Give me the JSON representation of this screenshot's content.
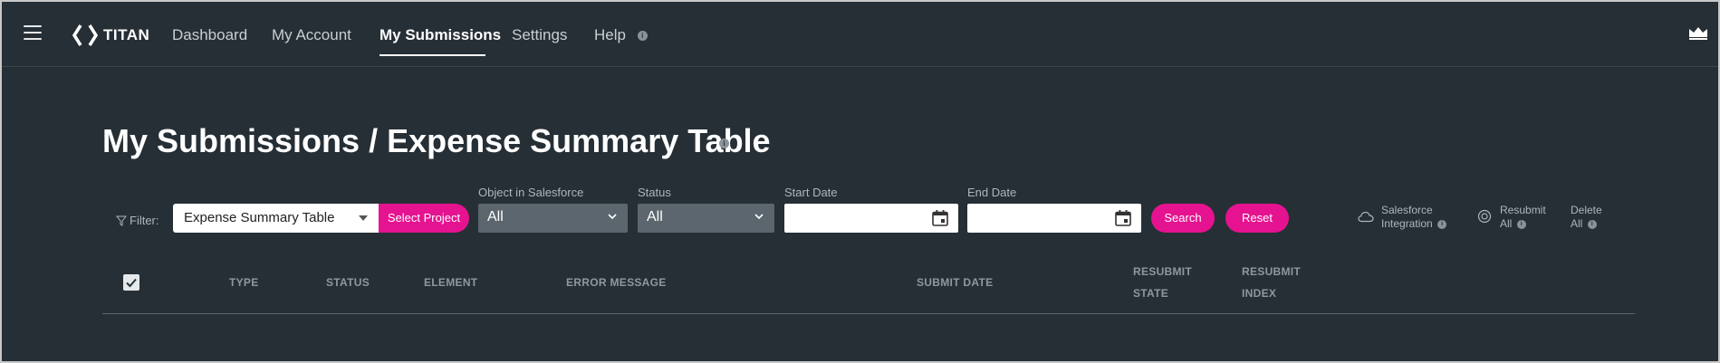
{
  "nav": {
    "brand": "TITAN",
    "items": [
      {
        "label": "Dashboard"
      },
      {
        "label": "My Account"
      },
      {
        "label": "My Submissions",
        "active": true
      },
      {
        "label": "Settings"
      },
      {
        "label": "Help"
      }
    ],
    "info_glyph": "i",
    "icons": [
      "menu-icon",
      "titan-logo-icon",
      "info-icon",
      "crown-icon"
    ]
  },
  "page": {
    "title": "My Submissions / Expense Summary Table"
  },
  "filter": {
    "label": "Filter:",
    "project_value": "Expense Summary Table",
    "select_project_label": "Select Project",
    "object_label": "Object in Salesforce",
    "object_value": "All",
    "status_label": "Status",
    "status_value": "All",
    "start_date_label": "Start Date",
    "start_date_value": "",
    "end_date_label": "End Date",
    "end_date_value": "",
    "search_label": "Search",
    "reset_label": "Reset"
  },
  "actions": {
    "salesforce_line1": "Salesforce",
    "salesforce_line2": "Integration",
    "resubmit_line1": "Resubmit",
    "resubmit_line2": "All",
    "delete_line1": "Delete",
    "delete_line2": "All"
  },
  "table": {
    "select_all_checked": true,
    "columns": {
      "type": "TYPE",
      "status": "STATUS",
      "element": "ELEMENT",
      "error_message": "ERROR MESSAGE",
      "submit_date": "SUBMIT DATE",
      "resubmit_state_1": "RESUBMIT",
      "resubmit_state_2": "STATE",
      "resubmit_index_1": "RESUBMIT",
      "resubmit_index_2": "INDEX"
    }
  },
  "colors": {
    "background": "#262f35",
    "accent": "#e5138f",
    "dark_select": "#5b666e",
    "muted_text": "#aeb6bb"
  }
}
